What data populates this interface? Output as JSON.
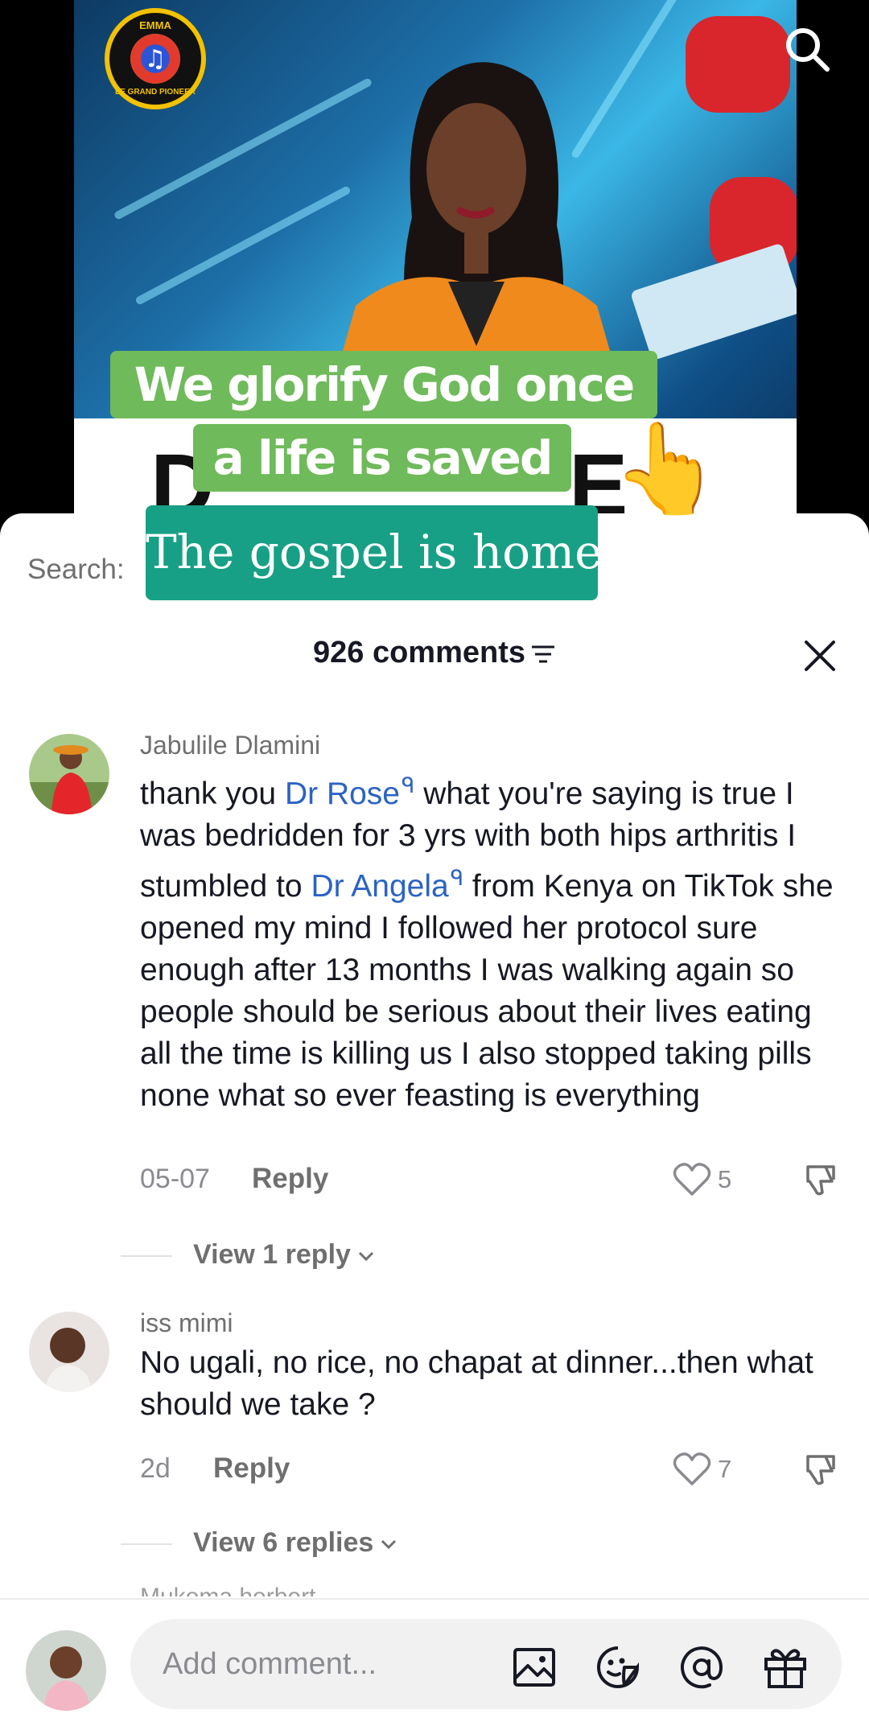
{
  "video": {
    "logo_top": "EMMA",
    "logo_bottom": "LE GRAND PIONEER",
    "logo_note": "♫",
    "band_left": "D",
    "band_right": "E",
    "pointing_hand": "👆",
    "captions": [
      "We glorify God once",
      "a life is saved",
      "The gospel is home"
    ]
  },
  "sheet": {
    "search_label": "Search:",
    "comment_count": "926 comments"
  },
  "comments": [
    {
      "user": "Jabulile Dlamini",
      "text_parts": [
        "thank you ",
        "Dr Rose",
        " what you're saying is true I was bedridden for 3 yrs with both hips arthritis I stumbled to ",
        "Dr Angela",
        " from Kenya on TikTok she opened my mind I followed her protocol sure enough after 13 months I was walking again so people should be serious about their lives eating all the time is killing us I also stopped taking pills none what so ever feasting is everything"
      ],
      "date": "05-07",
      "reply_label": "Reply",
      "likes": "5",
      "view_replies": "View 1 reply"
    },
    {
      "user": "iss mimi",
      "text": "No ugali, no rice, no chapat at dinner...then what should we take ?",
      "date": "2d",
      "reply_label": "Reply",
      "likes": "7",
      "view_replies": "View 6 replies"
    }
  ],
  "next_comment_peek": "Mukoma herbert",
  "input": {
    "placeholder": "Add comment..."
  },
  "icons": {
    "search": "search-icon",
    "sort": "sort-icon",
    "close": "close-icon",
    "like": "heart-icon",
    "dislike": "dislike-icon",
    "image": "image-icon",
    "emoji": "emoji-icon",
    "mention": "at-icon",
    "gift": "gift-icon"
  },
  "colors": {
    "caption_green": "#6fba5a",
    "caption_teal": "#17a085",
    "mention_blue": "#2b63c5"
  }
}
